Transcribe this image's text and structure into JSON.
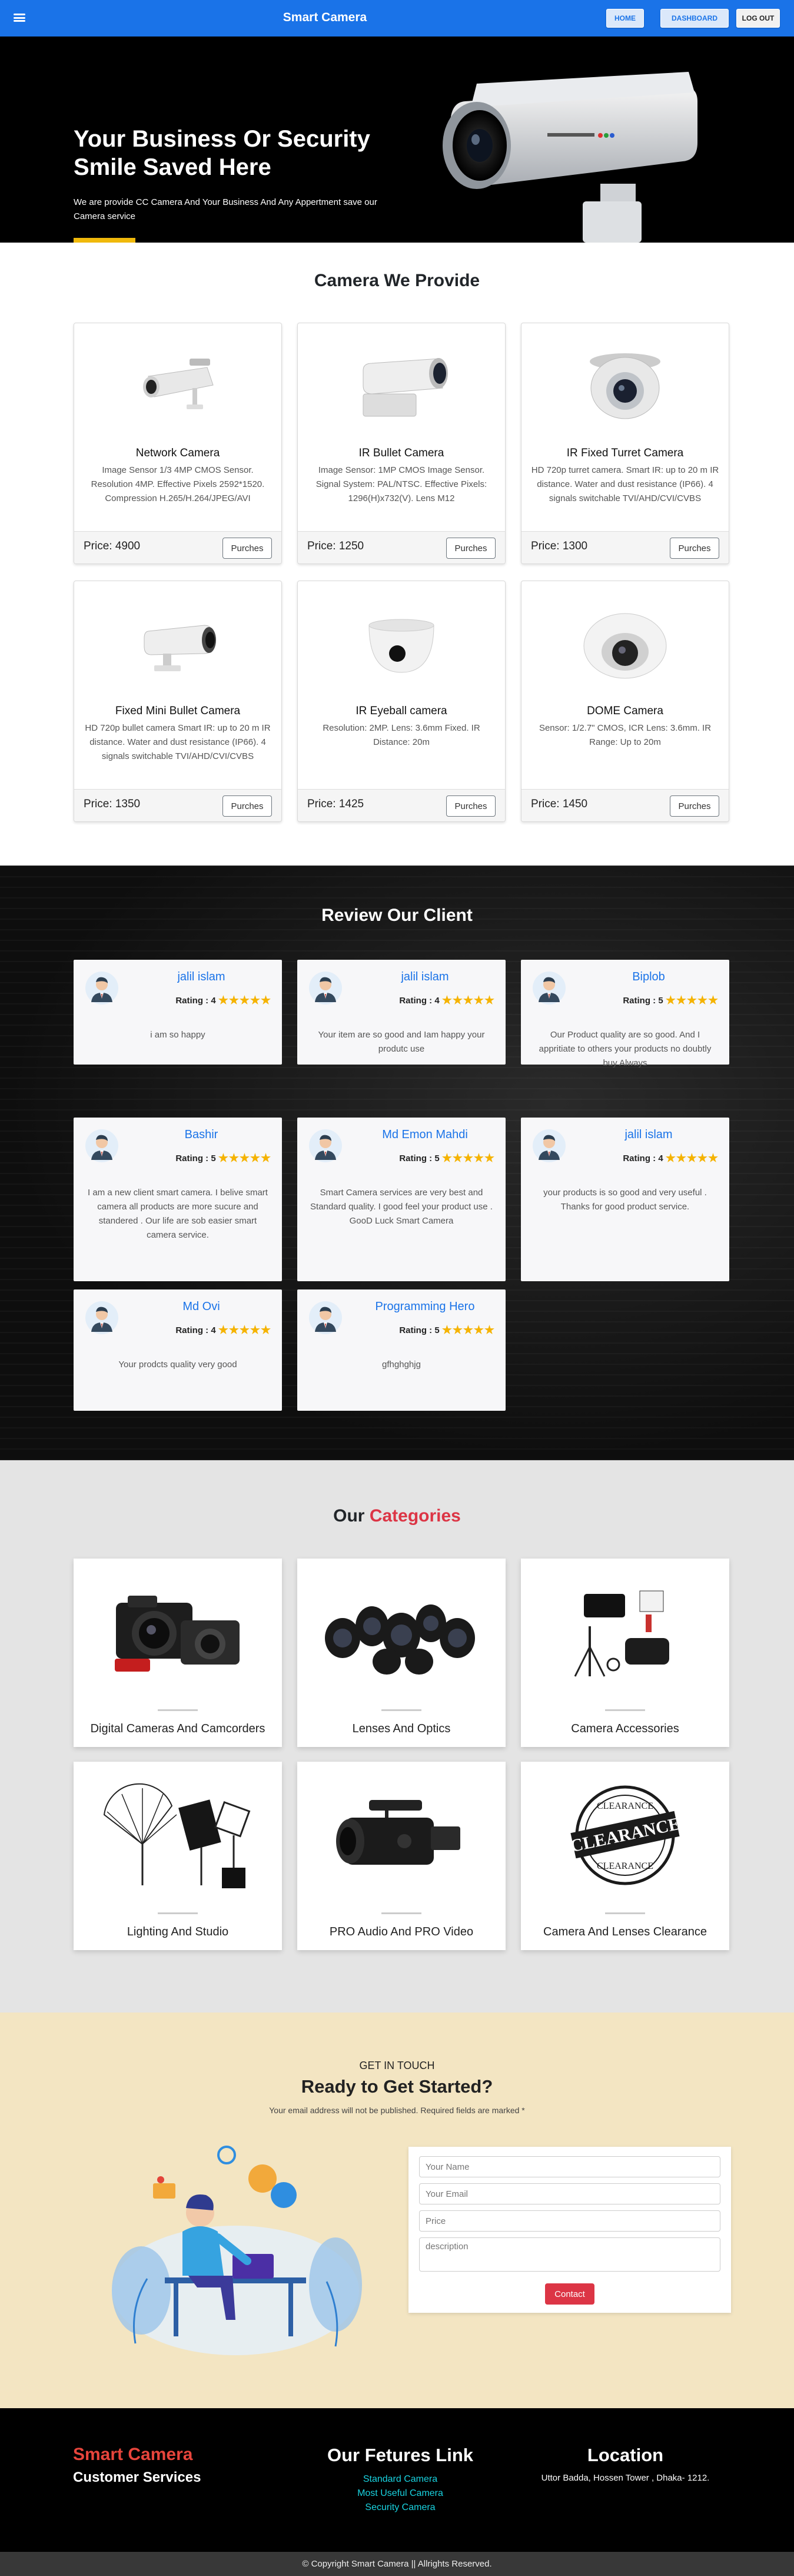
{
  "navbar": {
    "brand": "Smart Camera",
    "home": "HOME",
    "dashboard": "DASHBOARD",
    "logout": "LOG OUT"
  },
  "hero": {
    "title": "Your Business Or Security Smile Saved Here",
    "subtitle": "We are provide CC Camera And Your Business And Any Appertment save our Camera service"
  },
  "cameras": {
    "title": "Camera We Provide",
    "items": [
      {
        "name": "Network Camera",
        "desc": "Image Sensor 1/3 4MP CMOS Sensor. Resolution 4MP. Effective Pixels 2592*1520. Compression H.265/H.264/JPEG/AVI",
        "price": "Price: 4900",
        "button": "Purches"
      },
      {
        "name": "IR Bullet Camera",
        "desc": "Image Sensor: 1MP CMOS Image Sensor. Signal System: PAL/NTSC. Effective Pixels: 1296(H)x732(V). Lens M12",
        "price": "Price: 1250",
        "button": "Purches"
      },
      {
        "name": "IR Fixed Turret Camera",
        "desc": "HD 720p turret camera. Smart IR: up to 20 m IR distance. Water and dust resistance (IP66). 4 signals switchable TVI/AHD/CVI/CVBS",
        "price": "Price: 1300",
        "button": "Purches"
      },
      {
        "name": "Fixed Mini Bullet Camera",
        "desc": "HD 720p bullet camera Smart IR: up to 20 m IR distance. Water and dust resistance (IP66). 4 signals switchable TVI/AHD/CVI/CVBS",
        "price": "Price: 1350",
        "button": "Purches"
      },
      {
        "name": "IR Eyeball camera",
        "desc": "Resolution: 2MP. Lens: 3.6mm Fixed. IR Distance: 20m",
        "price": "Price: 1425",
        "button": "Purches"
      },
      {
        "name": "DOME Camera",
        "desc": "Sensor: 1/2.7\" CMOS, ICR Lens: 3.6mm. IR Range: Up to 20m",
        "price": "Price: 1450",
        "button": "Purches"
      }
    ]
  },
  "reviews": {
    "title": "Review Our Client",
    "rating_prefix": "Rating :",
    "items": [
      {
        "name": "jalil islam",
        "rating": "4",
        "stars": "★★★★★",
        "text": "i am so happy"
      },
      {
        "name": "jalil islam",
        "rating": "4",
        "stars": "★★★★★",
        "text": "Your item are so good and Iam happy your produtc use"
      },
      {
        "name": "Biplob",
        "rating": "5",
        "stars": "★★★★★",
        "text": "Our Product quality are so good. And I appritiate to others your products no doubtly buy Always"
      },
      {
        "name": "Bashir",
        "rating": "5",
        "stars": "★★★★★",
        "text": "I am a new client smart camera. I belive smart camera all products are more sucure and standered . Our life are sob easier smart camera service."
      },
      {
        "name": "Md Emon Mahdi",
        "rating": "5",
        "stars": "★★★★★",
        "text": "Smart Camera services are very best and Standard quality. I good feel your product use . GooD Luck Smart Camera"
      },
      {
        "name": "jalil islam",
        "rating": "4",
        "stars": "★★★★★",
        "text": "your products is so good and very useful . Thanks for good product service."
      },
      {
        "name": "Md Ovi",
        "rating": "4",
        "stars": "★★★★★",
        "text": "Your prodcts quality very good"
      },
      {
        "name": "Programming Hero",
        "rating": "5",
        "stars": "★★★★★",
        "text": "gfhghghjg"
      }
    ]
  },
  "categories": {
    "title_a": "Our",
    "title_b": "Categories",
    "accent": "#dc3545",
    "items": [
      {
        "name": "Digital Cameras And Camcorders"
      },
      {
        "name": "Lenses And Optics"
      },
      {
        "name": "Camera Accessories"
      },
      {
        "name": "Lighting And Studio"
      },
      {
        "name": "PRO Audio And PRO Video"
      },
      {
        "name": "Camera And Lenses Clearance",
        "stamp_top": "CLEARANCE",
        "stamp_mid": "CLEARANCE",
        "stamp_bot": "CLEARANCE"
      }
    ]
  },
  "contact": {
    "kicker": "GET IN TOUCH",
    "title": "Ready to Get Started?",
    "subtitle": "Your email address will not be published. Required fields are marked *",
    "name_placeholder": "Your Name",
    "email_placeholder": "Your Email",
    "price_placeholder": "Price",
    "desc_placeholder": "description",
    "button": "Contact"
  },
  "footer": {
    "brand": "Smart Camera",
    "services": "Customer Services",
    "links_title": "Our Fetures Link",
    "links": [
      "Standard Camera",
      "Most Useful Camera",
      "Security Camera"
    ],
    "location_title": "Location",
    "address": "Uttor Badda, Hossen Tower , Dhaka- 1212.",
    "copyright": "© Copyright Smart Camera || Allrights Reserved."
  },
  "colors": {
    "primary": "#1a73e8",
    "star": "#f5b301",
    "footer_brand": "#e8453c",
    "footer_link": "#19d3e0",
    "contact_bg": "#f3e5c2"
  }
}
